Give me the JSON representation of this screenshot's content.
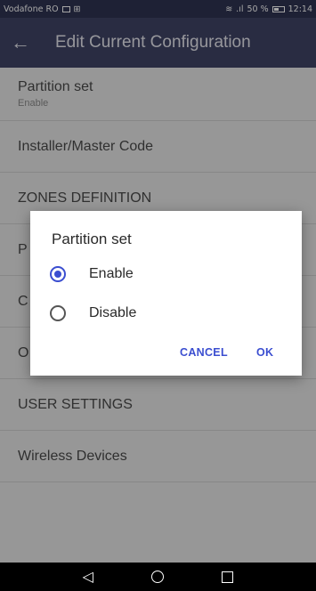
{
  "status_bar": {
    "carrier": "Vodafone RO",
    "signal_text": "50 %",
    "time": "12:14"
  },
  "app_bar": {
    "back_icon": "arrow-left-icon",
    "title": "Edit Current Configuration"
  },
  "list": {
    "items": [
      {
        "title": "Partition set",
        "subtitle": "Enable"
      },
      {
        "title": "Installer/Master Code"
      },
      {
        "title": "ZONES DEFINITION"
      },
      {
        "title": "P"
      },
      {
        "title": "C"
      },
      {
        "title": "O"
      },
      {
        "title": "USER SETTINGS"
      },
      {
        "title": "Wireless Devices"
      }
    ]
  },
  "dialog": {
    "title": "Partition set",
    "options": [
      {
        "label": "Enable",
        "selected": true
      },
      {
        "label": "Disable",
        "selected": false
      }
    ],
    "cancel_label": "CANCEL",
    "ok_label": "OK"
  },
  "colors": {
    "app_bar": "#3f4466",
    "status_bar": "#2f3352",
    "accent": "#3b4ed0"
  }
}
